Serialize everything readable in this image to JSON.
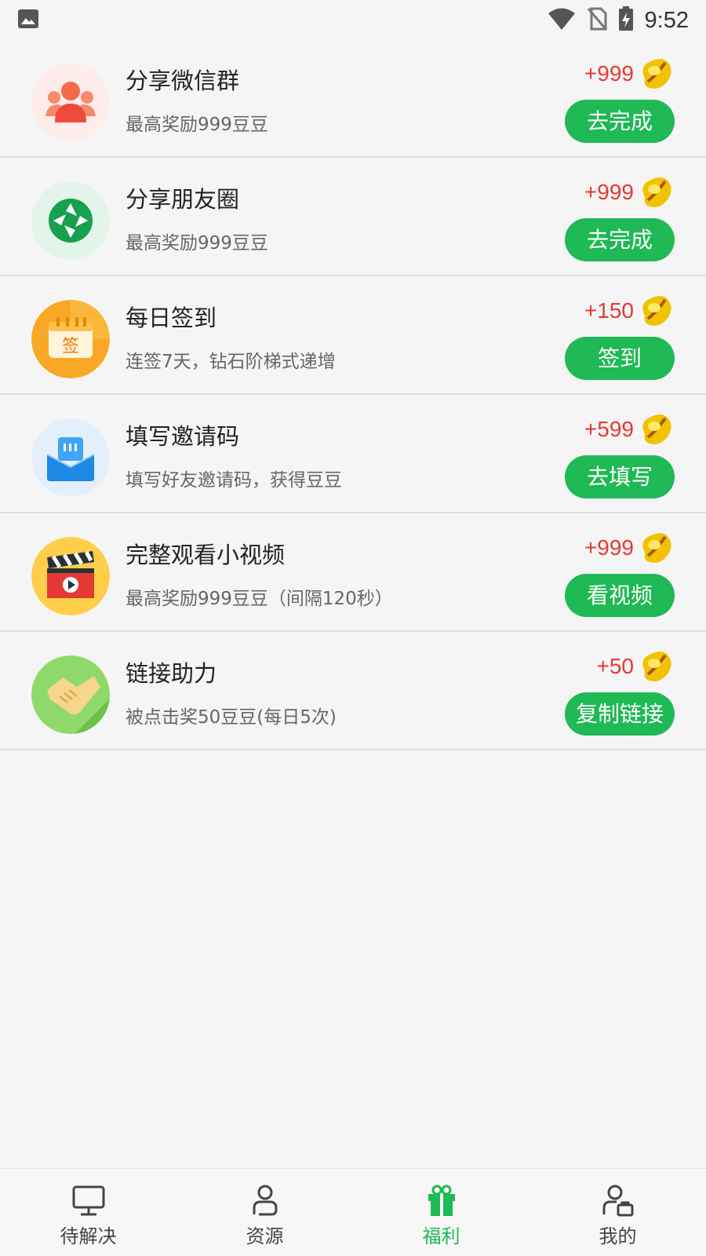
{
  "status_bar": {
    "time": "9:52"
  },
  "tasks": [
    {
      "title": "分享微信群",
      "desc": "最高奖励999豆豆",
      "reward": "+999",
      "button": "去完成",
      "icon": "wechat-group-icon"
    },
    {
      "title": "分享朋友圈",
      "desc": "最高奖励999豆豆",
      "reward": "+999",
      "button": "去完成",
      "icon": "moments-icon"
    },
    {
      "title": "每日签到",
      "desc": "连签7天，钻石阶梯式递增",
      "reward": "+150",
      "button": "签到",
      "icon": "calendar-sign-icon",
      "icon_text": "签"
    },
    {
      "title": "填写邀请码",
      "desc": "填写好友邀请码，获得豆豆",
      "reward": "+599",
      "button": "去填写",
      "icon": "invite-mail-icon"
    },
    {
      "title": "完整观看小视频",
      "desc": "最高奖励999豆豆（间隔120秒）",
      "reward": "+999",
      "button": "看视频",
      "icon": "video-clapper-icon"
    },
    {
      "title": "链接助力",
      "desc": "被点击奖50豆豆(每日5次)",
      "reward": "+50",
      "button": "复制链接",
      "icon": "handshake-icon"
    }
  ],
  "nav": [
    {
      "label": "待解决",
      "icon": "monitor-icon",
      "active": false
    },
    {
      "label": "资源",
      "icon": "person-icon",
      "active": false
    },
    {
      "label": "福利",
      "icon": "gift-icon",
      "active": true
    },
    {
      "label": "我的",
      "icon": "profile-bag-icon",
      "active": false
    }
  ],
  "colors": {
    "accent_green": "#1fb955",
    "reward_red": "#e53935",
    "background": "#f5f5f5"
  }
}
